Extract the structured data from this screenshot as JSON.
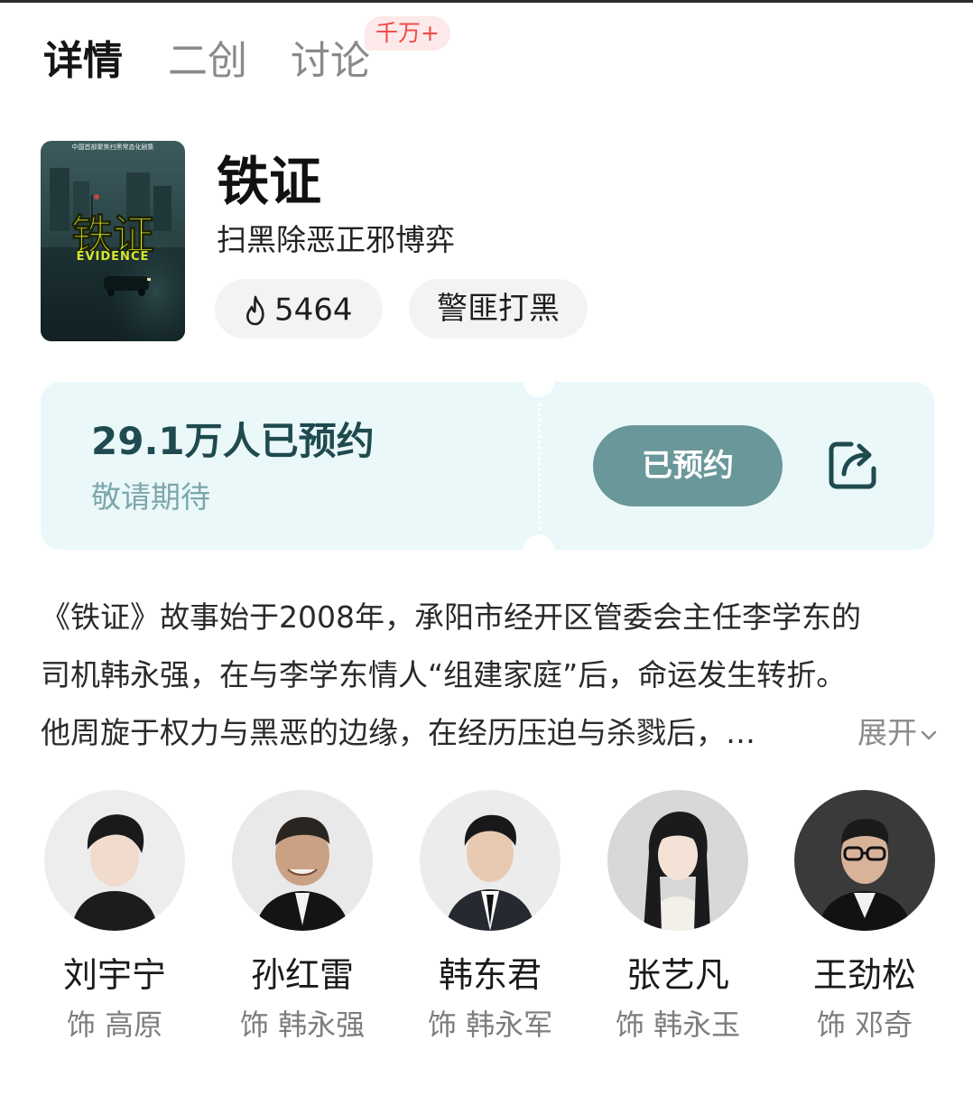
{
  "tabs": [
    {
      "label": "详情",
      "active": true
    },
    {
      "label": "二创",
      "active": false
    },
    {
      "label": "讨论",
      "active": false,
      "badge": "千万+"
    }
  ],
  "show": {
    "title": "铁证",
    "subtitle": "扫黑除恶正邪博弈",
    "poster": {
      "top_caption": "中国首部聚焦扫黑常态化剧集",
      "title_art": "铁证",
      "english_title": "EVIDENCE"
    },
    "heat": "5464",
    "genre_tag": "警匪打黑"
  },
  "reservation": {
    "count_text": "29.1万人已预约",
    "hint": "敬请期待",
    "button_label": "已预约",
    "share_icon": "share-icon"
  },
  "synopsis": {
    "lines": [
      "《铁证》故事始于2008年，承阳市经开区管委会主任李学东的",
      "司机韩永强，在与李学东情人“组建家庭”后，命运发生转折。",
      "他周旋于权力与黑恶的边缘，在经历压迫与杀戮后，…"
    ],
    "expand_label": "展开"
  },
  "cast": [
    {
      "name": "刘宇宁",
      "role": "饰 高原"
    },
    {
      "name": "孙红雷",
      "role": "饰 韩永强"
    },
    {
      "name": "韩东君",
      "role": "饰 韩永军"
    },
    {
      "name": "张艺凡",
      "role": "饰 韩永玉"
    },
    {
      "name": "王劲松",
      "role": "饰 邓奇"
    }
  ],
  "colors": {
    "accent_teal": "#6a9799",
    "card_bg": "#eaf8fa",
    "badge_red": "#f04848"
  }
}
